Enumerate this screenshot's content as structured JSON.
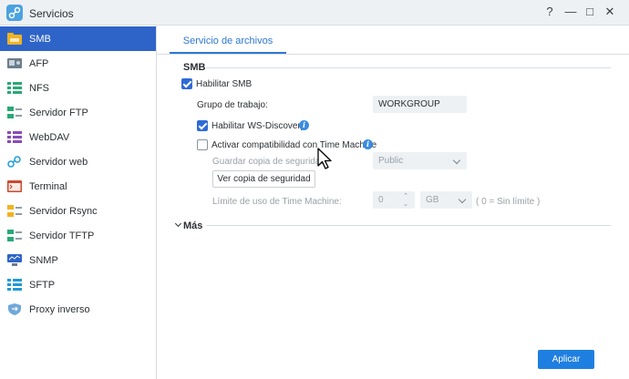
{
  "window": {
    "title": "Servicios",
    "help_glyph": "?",
    "minimize_glyph": "—",
    "maximize_glyph": "□",
    "close_glyph": "✕"
  },
  "sidebar": {
    "items": [
      {
        "label": "SMB",
        "icon": "smb-folder-icon",
        "active": true
      },
      {
        "label": "AFP",
        "icon": "afp-icon"
      },
      {
        "label": "NFS",
        "icon": "nfs-icon"
      },
      {
        "label": "Servidor FTP",
        "icon": "ftp-icon"
      },
      {
        "label": "WebDAV",
        "icon": "webdav-icon"
      },
      {
        "label": "Servidor web",
        "icon": "web-server-icon"
      },
      {
        "label": "Terminal",
        "icon": "terminal-icon"
      },
      {
        "label": "Servidor Rsync",
        "icon": "rsync-icon"
      },
      {
        "label": "Servidor TFTP",
        "icon": "tftp-icon"
      },
      {
        "label": "SNMP",
        "icon": "snmp-icon"
      },
      {
        "label": "SFTP",
        "icon": "sftp-icon"
      },
      {
        "label": "Proxy inverso",
        "icon": "reverse-proxy-shield-icon"
      }
    ]
  },
  "tabs": [
    {
      "label": "Servicio de archivos",
      "active": true
    }
  ],
  "smb": {
    "section_title": "SMB",
    "enable_label": "Habilitar SMB",
    "enable_checked": true,
    "workgroup_label": "Grupo de trabajo:",
    "workgroup_value": "WORKGROUP",
    "ws_discovery_label": "Habilitar WS-Discovery",
    "ws_discovery_checked": true,
    "time_machine_label": "Activar compatibilidad con Time Machine",
    "time_machine_checked": false,
    "backup_label": "Guardar copia de seguridad",
    "backup_value": "Public",
    "view_backup_button": "Ver copia de seguridad",
    "limit_label": "Límite de uso de Time Machine:",
    "limit_value": "0",
    "limit_unit": "GB",
    "limit_note": "( 0 = Sin límite )"
  },
  "more": {
    "section_title": "Más"
  },
  "footer": {
    "apply_label": "Aplicar"
  },
  "colors": {
    "accent": "#2e64c8",
    "primary_button": "#1f7fe0",
    "info": "#3a8be0"
  }
}
